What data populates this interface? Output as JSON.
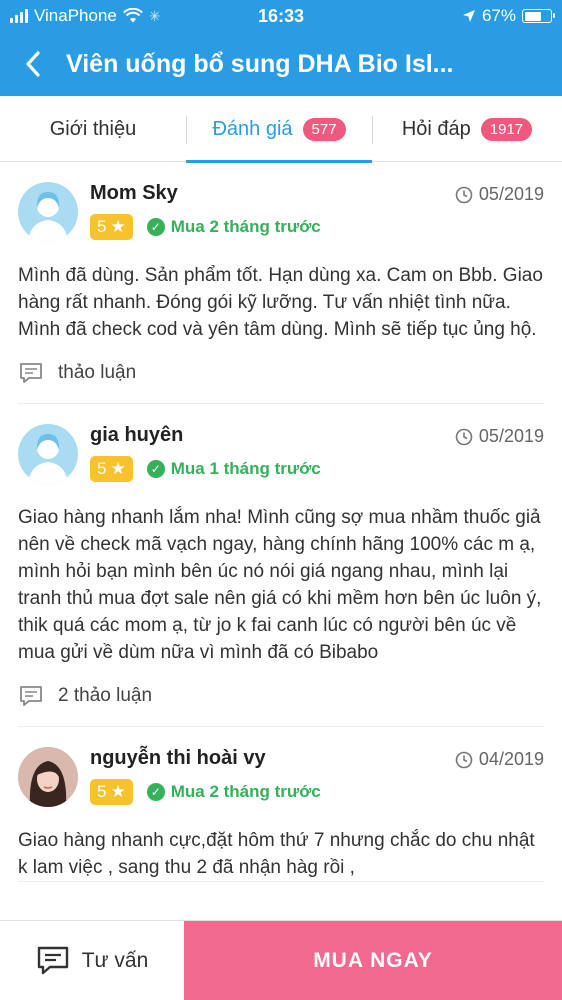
{
  "status_bar": {
    "carrier": "VinaPhone",
    "time": "16:33",
    "battery": "67%",
    "battery_level": 0.67
  },
  "nav": {
    "title": "Viên uống bổ sung DHA Bio Isl..."
  },
  "tabs": [
    {
      "label": "Giới thiệu"
    },
    {
      "label": "Đánh giá",
      "count": "577"
    },
    {
      "label": "Hỏi đáp",
      "count": "1917"
    }
  ],
  "reviews": [
    {
      "name": "Mom Sky",
      "rating": "5",
      "verified": "Mua 2 tháng trước",
      "date": "05/2019",
      "text": "Mình đã dùng. Sản phẩm tốt. Hạn dùng xa. Cam on Bbb. Giao hàng rất nhanh. Đóng gói kỹ lưỡng. Tư vấn nhiệt tình nữa. Mình đã check cod và yên tâm dùng. Mình sẽ tiếp tục ủng hộ.",
      "discussion": "thảo luận"
    },
    {
      "name": "gia huyên",
      "rating": "5",
      "verified": "Mua 1 tháng trước",
      "date": "05/2019",
      "text": "Giao hàng nhanh lắm nha! Mình cũng sợ mua nhầm thuốc giả nên về check mã vạch ngay, hàng chính hãng 100% các m ạ, mình hỏi bạn mình bên úc nó nói giá ngang nhau, mình lại tranh thủ mua đợt sale nên giá có khi mềm hơn bên úc luôn ý, thik quá các mom ạ, từ jo k fai canh lúc có người bên úc về mua gửi về dùm nữa vì mình đã có Bibabo",
      "discussion": "2 thảo luận"
    },
    {
      "name": "nguyễn thi hoài vy",
      "rating": "5",
      "verified": "Mua 2 tháng trước",
      "date": "04/2019",
      "text": "Giao hàng nhanh cực,đặt hôm thứ 7 nhưng chắc do chu nhật k lam việc , sang thu 2 đã nhận hàg rồi ,",
      "discussion": ""
    }
  ],
  "footer": {
    "consult_label": "Tư vấn",
    "buy_label": "MUA NGAY"
  },
  "colors": {
    "primary": "#2a9ce4",
    "badge": "#f0587e",
    "rating": "#f8c22c",
    "verified": "#35b15a",
    "buy": "#f1698e"
  }
}
